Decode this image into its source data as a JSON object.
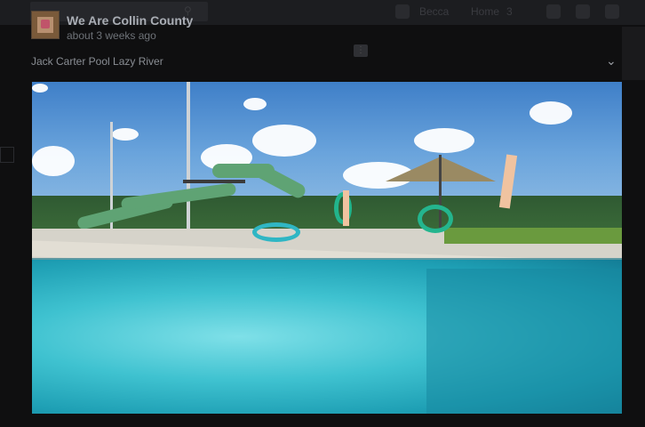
{
  "post": {
    "page_name": "We Are Collin County",
    "timestamp": "about 3 weeks ago",
    "caption": "Jack Carter Pool Lazy River"
  },
  "topbar": {
    "profile_name": "Becca",
    "home_label": "Home",
    "home_count": "3"
  },
  "icons": {
    "search": "search-icon",
    "more": "more-options-icon",
    "collapse": "chevron-down-icon"
  },
  "video": {
    "description_icon": "video-frame"
  },
  "colors": {
    "background": "#0f0f10",
    "title_text": "#a9adb4",
    "meta_text": "#6e7278"
  }
}
